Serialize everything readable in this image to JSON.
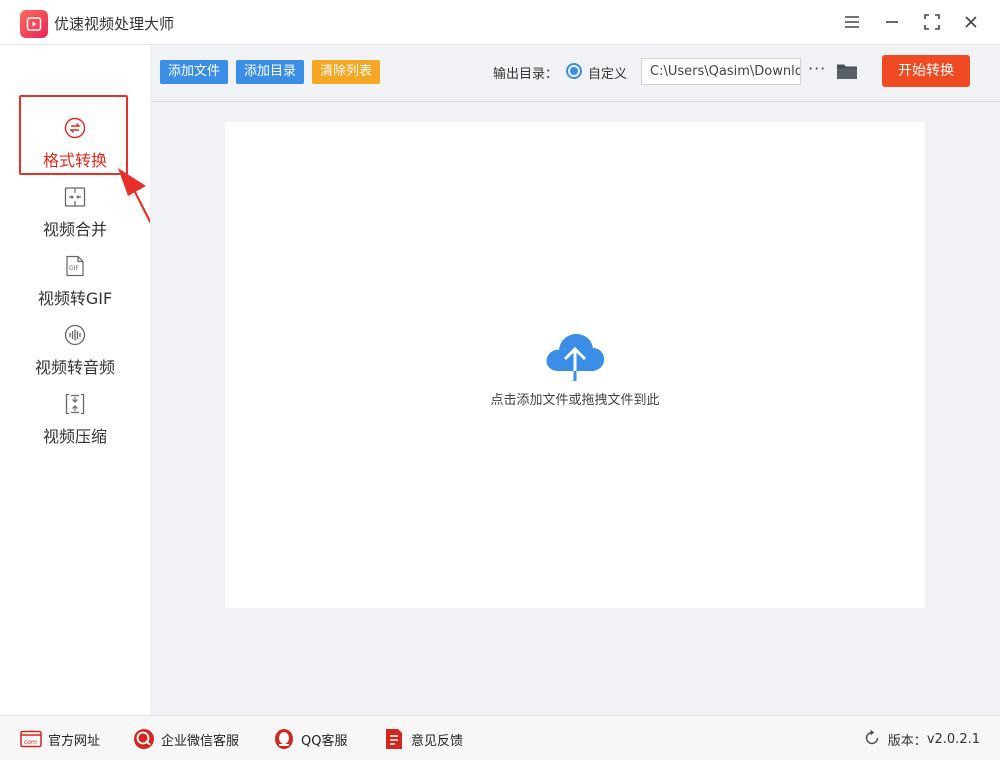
{
  "app": {
    "title": "优速视频处理大师"
  },
  "window_controls": [
    "menu-icon",
    "minimize-icon",
    "maximize-icon",
    "close-icon"
  ],
  "sidebar": {
    "items": [
      {
        "label": "格式转换",
        "icon": "convert-icon",
        "active": true
      },
      {
        "label": "视频合并",
        "icon": "merge-icon",
        "active": false
      },
      {
        "label": "视频转GIF",
        "icon": "gif-icon",
        "active": false
      },
      {
        "label": "视频转音频",
        "icon": "audio-icon",
        "active": false
      },
      {
        "label": "视频压缩",
        "icon": "compress-icon",
        "active": false
      }
    ]
  },
  "toolbar": {
    "add_file": "添加文件",
    "add_dir": "添加目录",
    "clear_list": "清除列表",
    "output_label": "输出目录：",
    "custom_label": "自定义",
    "output_path": "C:\\Users\\Qasim\\Downloads",
    "more": "···",
    "start": "开始转换"
  },
  "dropzone": {
    "hint": "点击添加文件或拖拽文件到此"
  },
  "footer": {
    "links": [
      "官方网址",
      "企业微信客服",
      "QQ客服",
      "意见反馈"
    ],
    "version_label": "版本：",
    "version": "v2.0.2.1"
  },
  "colors": {
    "accent_blue": "#3a8ee6",
    "accent_orange": "#f5a623",
    "start_red": "#f04a23",
    "active_red": "#e02a1f"
  }
}
